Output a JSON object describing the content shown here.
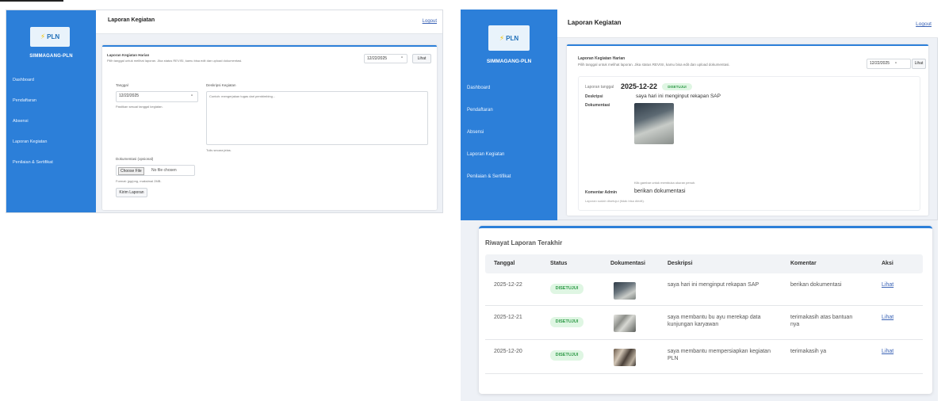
{
  "brand": {
    "logo_text": "PLN",
    "name": "SIMMAGANG-PLN"
  },
  "nav": [
    "Dashboard",
    "Pendaftaran",
    "Absensi",
    "Laporan Kegiatan",
    "Penilaian & Sertifikat"
  ],
  "header": {
    "title": "Laporan Kegiatan",
    "logout": "Logout"
  },
  "left_form": {
    "section_title": "Laporan Kegiatan Harian",
    "section_hint": "Pilih tanggal untuk melihat laporan. Jika status REVISI, kamu bisa edit dan upload dokumentasi.",
    "date_value": "12/22/2025",
    "view_btn": "Lihat",
    "tanggal_label": "Tanggal",
    "tanggal_value": "12/22/2025",
    "tanggal_hint": "Pastikan sesuai tanggal kegiatan.",
    "deskripsi_label": "Deskripsi Kegiatan",
    "deskripsi_placeholder": "Contoh: mengerjakan tugas dari pembimbing...",
    "deskripsi_hint": "Tulis secara jelas.",
    "dok_label": "Dokumentasi (opsional)",
    "file_btn": "Choose File",
    "file_status": "No file chosen",
    "file_hint": "Format: jpg/png, maksimal 2MB.",
    "submit_btn": "Kirim Laporan"
  },
  "right_detail": {
    "section_title": "Laporan Kegiatan Harian",
    "section_hint": "Pilih tanggal untuk melihat laporan. Jika status REVISI, kamu bisa edit dan upload dokumentasi.",
    "date_value": "12/22/2025",
    "view_btn": "Lihat",
    "report_label": "Laporan tanggal",
    "report_date": "2025-12-22",
    "status": "DISETUJUI",
    "desk_label": "Deskripsi",
    "desk_value": "saya hari ini menginput rekapan SAP",
    "dok_label": "Dokumentasi",
    "dok_hint": "Klik gambar untuk membuka ukuran penuh.",
    "komentar_label": "Komentar Admin",
    "komentar_value": "berikan dokumentasi",
    "locked_note": "Laporan sudah disetujui (tidak bisa diedit)."
  },
  "history": {
    "title": "Riwayat Laporan Terakhir",
    "columns": [
      "Tanggal",
      "Status",
      "Dokumentasi",
      "Deskripsi",
      "Komentar",
      "Aksi"
    ],
    "rows": [
      {
        "tanggal": "2025-12-22",
        "status": "DISETUJUI",
        "deskripsi": "saya hari ini menginput rekapan SAP",
        "komentar": "berikan dokumentasi",
        "aksi": "Lihat"
      },
      {
        "tanggal": "2025-12-21",
        "status": "DISETUJUI",
        "deskripsi": "saya membantu bu ayu merekap data kunjungan karyawan",
        "komentar": "terimakasih atas bantuan nya",
        "aksi": "Lihat"
      },
      {
        "tanggal": "2025-12-20",
        "status": "DISETUJUI",
        "deskripsi": "saya membantu mempersiapkan kegiatan PLN",
        "komentar": "terimakasih ya",
        "aksi": "Lihat"
      }
    ]
  },
  "colors": {
    "sidebar": "#2c7fd9",
    "badge_bg": "#dff6e3",
    "badge_text": "#2e9a47",
    "link": "#3a62b5"
  }
}
